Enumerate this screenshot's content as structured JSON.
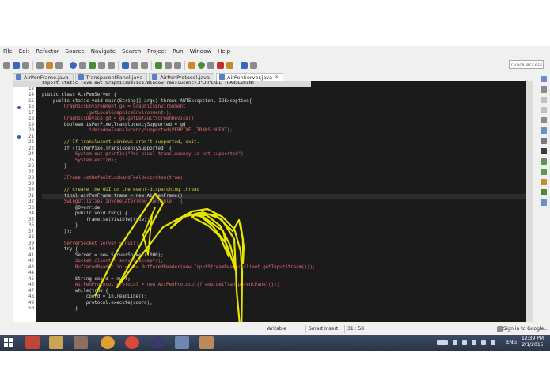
{
  "menu": [
    "File",
    "Edit",
    "Refactor",
    "Source",
    "Navigate",
    "Search",
    "Project",
    "Run",
    "Window",
    "Help"
  ],
  "quick_access_placeholder": "Quick Access",
  "tabs": [
    {
      "label": "AirPenFrame.java",
      "active": false
    },
    {
      "label": "TransparentPanel.java",
      "active": false
    },
    {
      "label": "AirPenProtocol.java",
      "active": false
    },
    {
      "label": "AirPenServer.java",
      "active": true
    }
  ],
  "editor": {
    "first_line": "import static java.awt.GraphicsDevice.WindowTranslucency.PERPIXEL_TRANSLUCENT;",
    "line_numbers": [
      "13",
      "14",
      "15",
      "16",
      "17",
      "18",
      "19",
      "20",
      "21",
      "22",
      "23",
      "24",
      "25",
      "26",
      "27",
      "28",
      "29",
      "30",
      "31",
      "32",
      "33",
      "34",
      "35",
      "36",
      "37",
      "38",
      "39",
      "40",
      "41",
      "42",
      "43",
      "44",
      "45",
      "46",
      "47",
      "48",
      "49",
      "50"
    ],
    "lines": [
      "",
      "public class AirPenServer {",
      "    public static void main(String[] args) throws AWTException, IOException{",
      "        GraphicsEnvironment ge = GraphicsEnvironment",
      "                .getLocalGraphicsEnvironment();",
      "        GraphicsDevice gd = ge.getDefaultScreenDevice();",
      "        boolean isPerPixelTranslucencySupported = gd",
      "                .isWindowTranslucencySupported(PERPIXEL_TRANSLUCENT);",
      "",
      "        // If translucent windows aren't supported, exit.",
      "        if (!isPerPixelTranslucencySupported) {",
      "            System.out.println(\"Per-pixel translucency is not supported\");",
      "            System.exit(0);",
      "        }",
      "",
      "        JFrame.setDefaultLookAndFeelDecorated(true);",
      "",
      "        // Create the GUI on the event-dispatching thread",
      "        final AirPenFrame frame = new AirPenFrame();",
      "        SwingUtilities.invokeLater(new Runnable() {",
      "            @Override",
      "            public void run() {",
      "                frame.setVisible(true);",
      "            }",
      "        });",
      "",
      "        ServerSocket server = null;",
      "        try {",
      "            Server = new ServerSocket(1000);",
      "            Socket client = server.accept();",
      "            BufferedReader in = new BufferedReader(new InputStreamReader(client.getInputStream()));",
      "",
      "            String coord = null;",
      "            AirPenProtocol protocol = new AirPenProtocol(frame.getTransparentPanel());",
      "            while(true){",
      "                coord = in.readLine();",
      "                protocol.execute(coord);",
      "            }"
    ]
  },
  "status": {
    "writable": "Writable",
    "insert_mode": "Smart Insert",
    "position": "31 : 58",
    "sign_in": "Sign in to Google..."
  },
  "taskbar": {
    "language": "ENG",
    "time": "12:39 PM",
    "date": "2/1/2015"
  },
  "colors": {
    "keyword": "#e8e8e8",
    "comment": "#d6d245",
    "type": "#e06c75",
    "string": "#d6d245",
    "plain": "#dcdcdc",
    "pen_stroke": "#e6e600"
  }
}
